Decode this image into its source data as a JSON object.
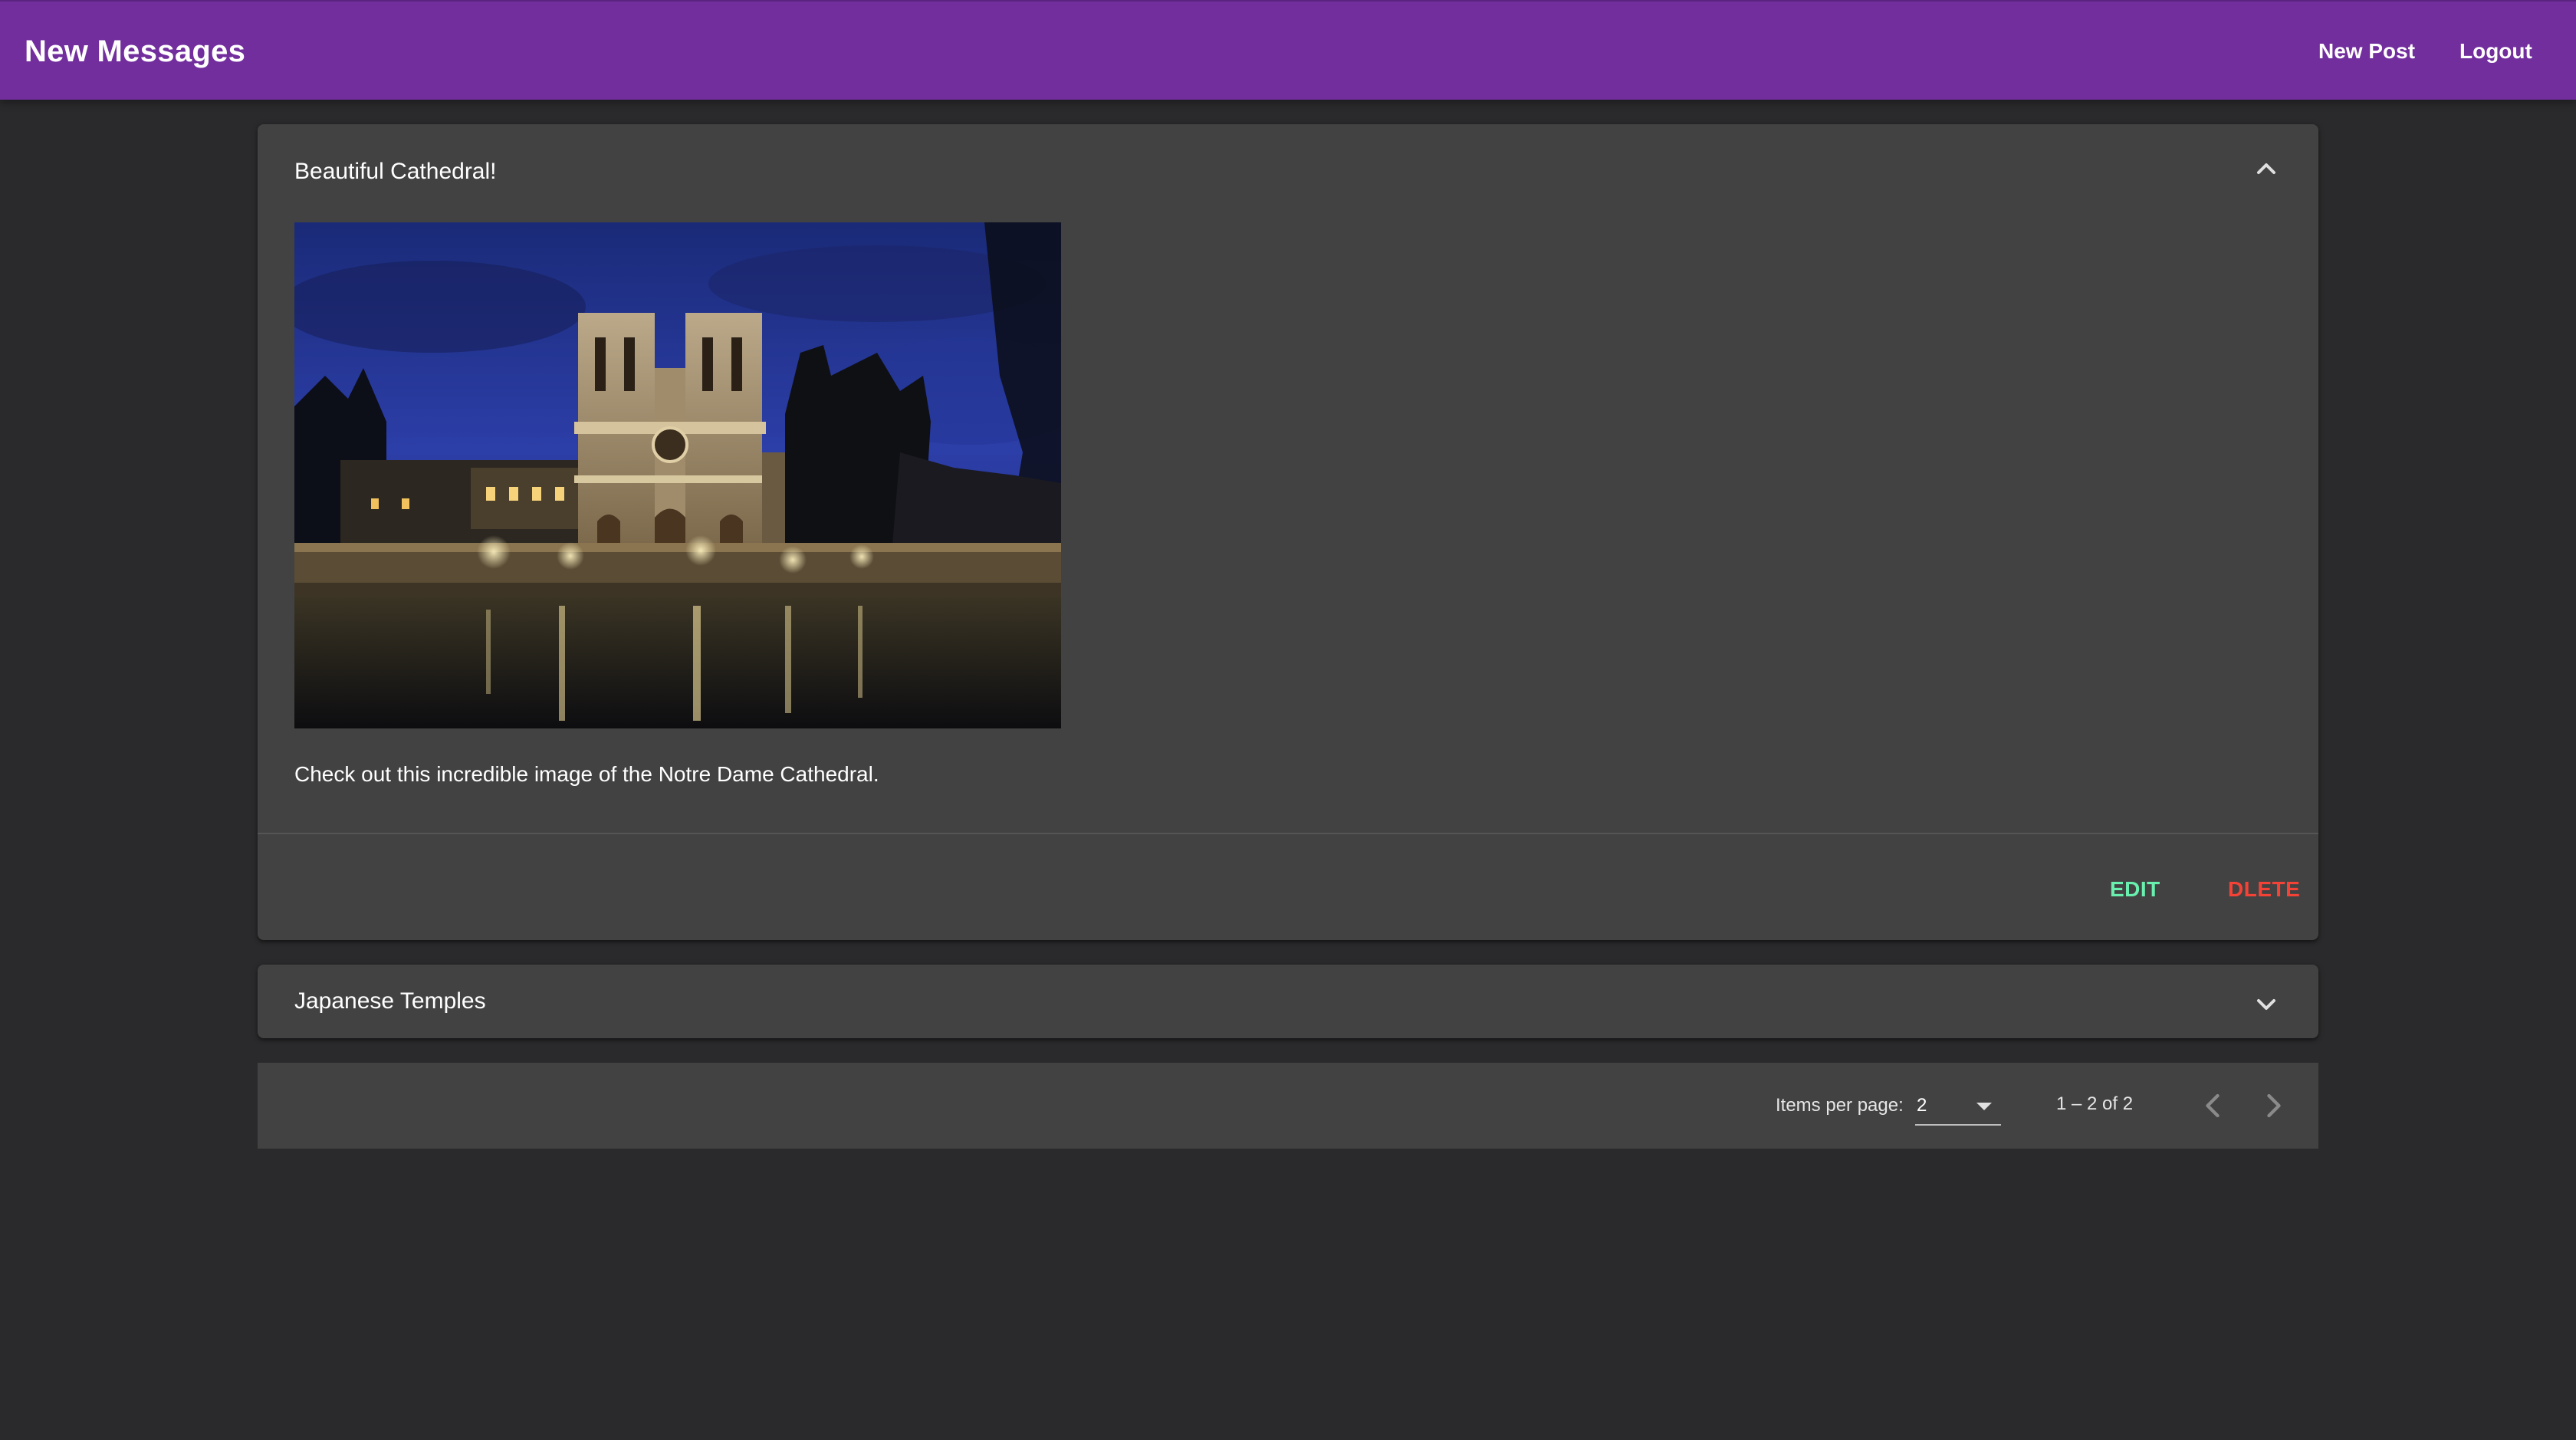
{
  "toolbar": {
    "title": "New Messages",
    "new_post_label": "New Post",
    "logout_label": "Logout",
    "color": "#722e9d"
  },
  "posts": [
    {
      "title": "Beautiful Cathedral!",
      "expanded": true,
      "image": "notre-dame-cathedral-night-photo",
      "content": "Check out this incredible image of the Notre Dame Cathedral.",
      "edit_label": "EDIT",
      "delete_label": "DLETE",
      "toggle_icon": "chevron-up-icon"
    },
    {
      "title": "Japanese Temples",
      "expanded": false,
      "toggle_icon": "chevron-down-icon"
    }
  ],
  "paginator": {
    "items_per_page_label": "Items per page:",
    "items_per_page_value": "2",
    "range_label": "1 – 2 of 2",
    "prev_icon": "chevron-left-icon",
    "next_icon": "chevron-right-icon"
  },
  "colors": {
    "background": "#2a2a2c",
    "panel": "#424242",
    "edit": "#69f0ae",
    "delete": "#f44336"
  }
}
